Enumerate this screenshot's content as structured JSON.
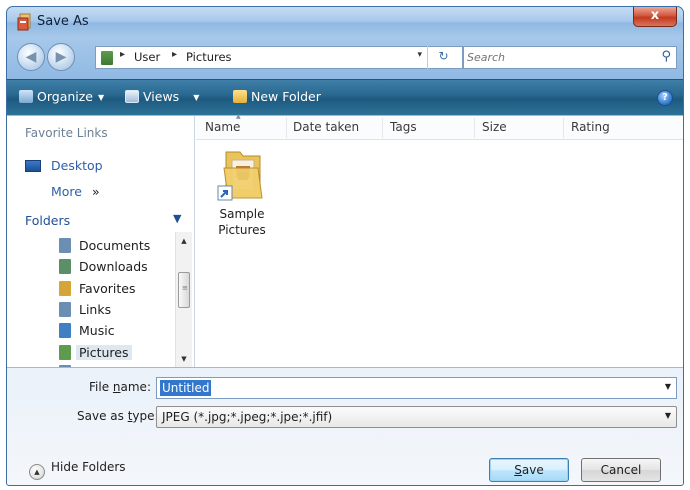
{
  "window": {
    "title": "Save As",
    "close_label": "x"
  },
  "address": {
    "crumbs": [
      "User",
      "Pictures"
    ],
    "search_placeholder": "Search"
  },
  "toolbar": {
    "organize_label": "Organize",
    "views_label": "Views",
    "new_folder_label": "New Folder",
    "help_label": "?"
  },
  "navpane": {
    "favorite_links_header": "Favorite Links",
    "desktop_label": "Desktop",
    "more_label": "More",
    "more_chevrons": "»",
    "folders_header": "Folders",
    "folders": [
      {
        "label": "Documents",
        "icon": "documents-folder-icon",
        "color": "#6b8fb3"
      },
      {
        "label": "Downloads",
        "icon": "downloads-folder-icon",
        "color": "#5b8f67"
      },
      {
        "label": "Favorites",
        "icon": "favorites-folder-icon",
        "color": "#d6a53a"
      },
      {
        "label": "Links",
        "icon": "links-folder-icon",
        "color": "#6b8fb3"
      },
      {
        "label": "Music",
        "icon": "music-folder-icon",
        "color": "#3f7fc2"
      },
      {
        "label": "Pictures",
        "icon": "pictures-folder-icon",
        "color": "#5f9b4e",
        "selected": true
      }
    ]
  },
  "filepane": {
    "columns": [
      "Name",
      "Date taken",
      "Tags",
      "Size",
      "Rating"
    ],
    "items": [
      {
        "name_line1": "Sample",
        "name_line2": "Pictures",
        "icon": "shortcut-folder-icon"
      }
    ]
  },
  "form": {
    "file_name_label_pre": "File ",
    "file_name_label_acc": "n",
    "file_name_label_post": "ame:",
    "file_name_value": "Untitled",
    "save_type_label_pre": "Save as ",
    "save_type_label_acc": "t",
    "save_type_label_post": "ype:",
    "save_type_value": "JPEG (*.jpg;*.jpeg;*.jpe;*.jfif)"
  },
  "footer": {
    "hide_folders_label": "Hide Folders",
    "save_acc": "S",
    "save_rest": "ave",
    "cancel_label": "Cancel"
  },
  "colors": {
    "accent": "#3377cc",
    "toolbar": "#2b6a91",
    "close": "#c3391e"
  }
}
